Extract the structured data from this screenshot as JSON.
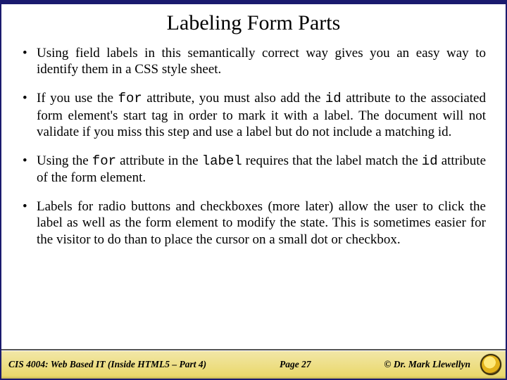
{
  "title": "Labeling Form Parts",
  "bullets": [
    {
      "pre": "Using field labels in this semantically correct way gives you an easy way to identify them in a CSS style sheet."
    },
    {
      "pre": "If you use the ",
      "code1": "for",
      "mid1": " attribute, you must also add the ",
      "code2": "id",
      "post": " attribute to the associated form element's start tag in order to mark it with a label.  The document will not validate if you miss this step and use a label but do not include a matching id."
    },
    {
      "pre": "Using the ",
      "code1": "for",
      "mid1": " attribute  in the ",
      "code2": "label",
      "mid2": " requires that the label match the ",
      "code3": "id",
      "post": " attribute of the form element."
    },
    {
      "pre": "Labels for radio buttons and checkboxes (more later) allow the user to click the label as well as the form element to modify the state.  This is sometimes easier for the visitor to do than to place the cursor on a small dot or checkbox."
    }
  ],
  "footer": {
    "course": "CIS 4004: Web Based IT (Inside HTML5 – Part 4)",
    "page": "Page 27",
    "author": "© Dr. Mark Llewellyn"
  }
}
